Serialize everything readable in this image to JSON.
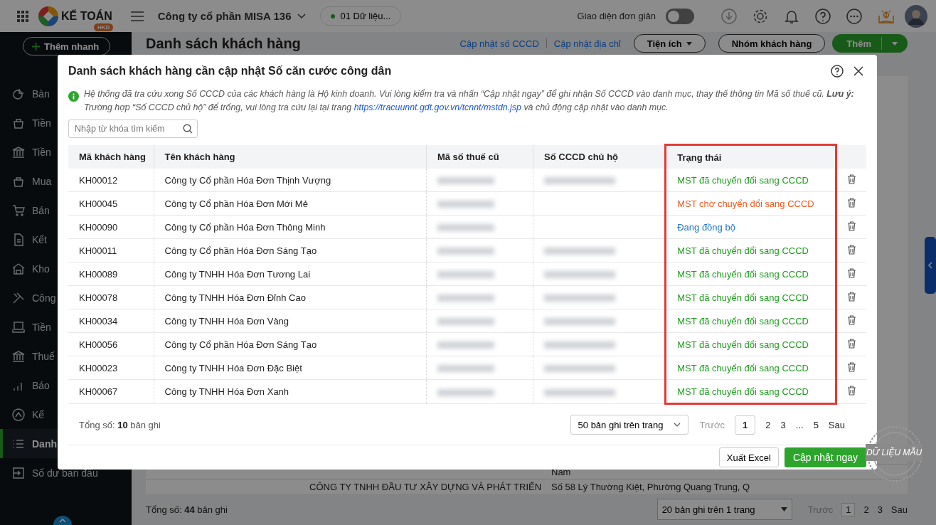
{
  "topbar": {
    "logo_text": "KẾ TOÁN",
    "logo_badge": "HKD",
    "company": "Công ty cổ phần MISA 136",
    "data_pill": "01 Dữ liệu...",
    "simple_ui_label": "Giao diện đơn giản",
    "simple_ui_on": false
  },
  "sidebar": {
    "quick_add": "Thêm nhanh",
    "items": [
      {
        "label": "Bàn",
        "selected": false
      },
      {
        "label": "Tiền",
        "selected": false
      },
      {
        "label": "Tiền",
        "selected": false
      },
      {
        "label": "Mua",
        "selected": false
      },
      {
        "label": "Bán",
        "selected": false
      },
      {
        "label": "Kết",
        "selected": false
      },
      {
        "label": "Kho",
        "selected": false
      },
      {
        "label": "Công",
        "selected": false
      },
      {
        "label": "Tiền",
        "selected": false
      },
      {
        "label": "Thuế",
        "selected": false
      },
      {
        "label": "Báo",
        "selected": false
      },
      {
        "label": "Kế",
        "selected": false
      },
      {
        "label": "Danh",
        "selected": true
      },
      {
        "label": "Số dư ban đầu",
        "selected": false
      }
    ]
  },
  "page": {
    "title": "Danh sách khách hàng",
    "links": [
      "Cập nhật số CCCD",
      "Cập nhật địa chỉ"
    ],
    "utility_button": "Tiện ích",
    "group_button": "Nhóm khách hàng",
    "add_button": "Thêm",
    "bottom_rows": [
      [
        "",
        "Nam"
      ],
      [
        "CÔNG TY TNHH ĐẦU TƯ XÂY DỰNG VÀ PHÁT TRIỂN",
        "Số 58 Lý Thường Kiệt, Phường Quang Trung, Q"
      ]
    ],
    "total_prefix": "Tổng số:",
    "total_count": "44",
    "total_suffix": "bản ghi",
    "page_size": "20 bản ghi trên 1 trang",
    "prev": "Trước",
    "pages": [
      {
        "label": "1",
        "selected": true
      },
      {
        "label": "2",
        "selected": false
      },
      {
        "label": "3",
        "selected": false
      }
    ],
    "next": "Sau",
    "stamp": "DỮ LIỆU MẪU"
  },
  "dialog": {
    "title": "Danh sách khách hàng cần cập nhật Số căn cước công dân",
    "notice": "Hệ thống đã tra cứu xong Số CCCD của các khách hàng là Hộ kinh doanh. Vui lòng kiểm tra và nhấn “Cập nhật ngay” để ghi nhận Số CCCD vào danh mục, thay thế thông tin Mã số thuế cũ. **Lưu ý:** Trường hợp “Số CCCD chủ hộ” để trống, vui lòng tra cứu lại tại trang",
    "notice_link": "https://tracuunnt.gdt.gov.vn/tcnnt/mstdn.jsp",
    "notice_end": "và chủ động cập nhật vào danh mục.",
    "search": {
      "placeholder": "Nhập từ khóa tìm kiếm"
    },
    "columns": [
      {
        "label": "Mã khách hàng",
        "highlighted": false
      },
      {
        "label": "Tên khách hàng",
        "highlighted": false
      },
      {
        "label": "Mã số thuế cũ",
        "highlighted": false
      },
      {
        "label": "Số CCCD chủ hộ",
        "highlighted": false
      },
      {
        "label": "Trạng thái",
        "highlighted": true
      }
    ],
    "rows": [
      {
        "code": "KH00012",
        "name": "Công ty Cổ phần Hóa Đơn Thịnh Vượng",
        "cccd_present": true,
        "status": "MST đã chuyển đổi sang CCCD",
        "kind": "converted"
      },
      {
        "code": "KH00045",
        "name": "Công ty Cổ phần Hóa Đơn Mới Mẻ",
        "cccd_present": false,
        "status": "MST chờ chuyển đổi sang CCCD",
        "kind": "pending"
      },
      {
        "code": "KH00090",
        "name": "Công ty Cổ phần Hóa Đơn Thông Minh",
        "cccd_present": false,
        "status": "Đang đồng bộ",
        "kind": "syncing"
      },
      {
        "code": "KH00011",
        "name": "Công ty Cổ phần Hóa Đơn Sáng Tạo",
        "cccd_present": true,
        "status": "MST đã chuyển đổi sang CCCD",
        "kind": "converted"
      },
      {
        "code": "KH00089",
        "name": "Công ty TNHH Hóa Đơn Tương Lai",
        "cccd_present": true,
        "status": "MST đã chuyển đổi sang CCCD",
        "kind": "converted"
      },
      {
        "code": "KH00078",
        "name": "Công ty TNHH Hóa Đơn Đỉnh Cao",
        "cccd_present": true,
        "status": "MST đã chuyển đổi sang CCCD",
        "kind": "converted"
      },
      {
        "code": "KH00034",
        "name": "Công ty TNHH Hóa Đơn Vàng",
        "cccd_present": true,
        "status": "MST đã chuyển đổi sang CCCD",
        "kind": "converted"
      },
      {
        "code": "KH00056",
        "name": "Công ty Cổ phần Hóa Đơn Sáng Tạo",
        "cccd_present": true,
        "status": "MST đã chuyển đổi sang CCCD",
        "kind": "converted"
      },
      {
        "code": "KH00023",
        "name": "Công ty TNHH Hóa Đơn Đặc Biệt",
        "cccd_present": true,
        "status": "MST đã chuyển đổi sang CCCD",
        "kind": "converted"
      },
      {
        "code": "KH00067",
        "name": "Công ty TNHH Hóa Đơn Xanh",
        "cccd_present": true,
        "status": "MST đã chuyển đổi sang CCCD",
        "kind": "converted"
      }
    ],
    "total_prefix": "Tổng số:",
    "total_count": "10",
    "total_suffix": "bản ghi",
    "page_size": "50 bản ghi trên trang",
    "prev": "Trước",
    "pages": [
      {
        "label": "1",
        "selected": true
      },
      {
        "label": "2",
        "selected": false
      },
      {
        "label": "3",
        "selected": false
      },
      {
        "label": "...",
        "selected": false
      },
      {
        "label": "5",
        "selected": false
      }
    ],
    "next": "Sau",
    "export_button": "Xuất Excel",
    "update_button": "Cập nhật ngay"
  }
}
